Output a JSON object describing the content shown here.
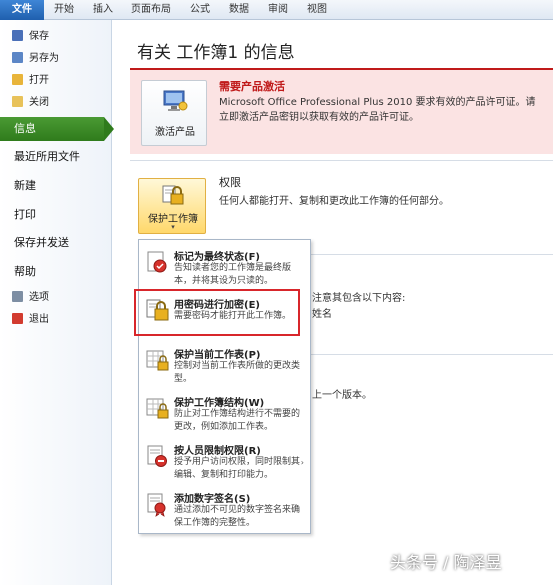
{
  "ribbon": {
    "tabs": [
      "文件",
      "开始",
      "插入",
      "页面布局",
      "公式",
      "数据",
      "审阅",
      "视图"
    ]
  },
  "sidebar": {
    "small_items": [
      {
        "label": "保存",
        "icon": "save-icon"
      },
      {
        "label": "另存为",
        "icon": "save-as-icon"
      },
      {
        "label": "打开",
        "icon": "open-folder-icon"
      },
      {
        "label": "关闭",
        "icon": "close-folder-icon"
      }
    ],
    "active_item": "信息",
    "big_items": [
      "最近所用文件",
      "新建",
      "打印",
      "保存并发送",
      "帮助"
    ],
    "bottom_items": [
      {
        "label": "选项",
        "icon": "options-icon"
      },
      {
        "label": "退出",
        "icon": "exit-icon"
      }
    ]
  },
  "main": {
    "title": "有关 工作簿1 的信息",
    "activation": {
      "button_label": "激活产品",
      "title": "需要产品激活",
      "description": "Microsoft Office Professional Plus 2010 要求有效的产品许可证。请立即激活产品密钥以获取有效的产品许可证。"
    },
    "permissions": {
      "button_label": "保护工作簿",
      "arrow": "▾",
      "title": "权限",
      "description": "任何人都能打开、复制和更改此工作簿的任何部分。"
    },
    "hidden_text": {
      "line1": "注意其包含以下内容:",
      "line2": "姓名",
      "line3": "上一个版本。"
    }
  },
  "menu": {
    "items": [
      {
        "title": "标记为最终状态(F)",
        "description": "告知读者您的工作簿是最终版本，并将其设为只读的。",
        "icon": "mark-final-icon"
      },
      {
        "title": "用密码进行加密(E)",
        "description": "需要密码才能打开此工作簿。",
        "icon": "encrypt-password-icon"
      },
      {
        "title": "保护当前工作表(P)",
        "description": "控制对当前工作表所做的更改类型。",
        "icon": "protect-sheet-icon"
      },
      {
        "title": "保护工作簿结构(W)",
        "description": "防止对工作簿结构进行不需要的更改，例如添加工作表。",
        "icon": "protect-structure-icon"
      },
      {
        "title": "按人员限制权限(R)",
        "description": "授予用户访问权限，同时限制其编辑、复制和打印能力。",
        "icon": "restrict-permission-icon"
      },
      {
        "title": "添加数字签名(S)",
        "description": "通过添加不可见的数字签名来确保工作簿的完整性。",
        "icon": "digital-signature-icon"
      }
    ],
    "submenu_arrow": "›"
  },
  "watermark": "头条号 / 陶泽昱",
  "colors": {
    "accent_green": "#2f7b1c",
    "activation_red": "#c01a1a",
    "activation_bg": "#fbe3e3",
    "highlight_red": "#d8262b"
  }
}
